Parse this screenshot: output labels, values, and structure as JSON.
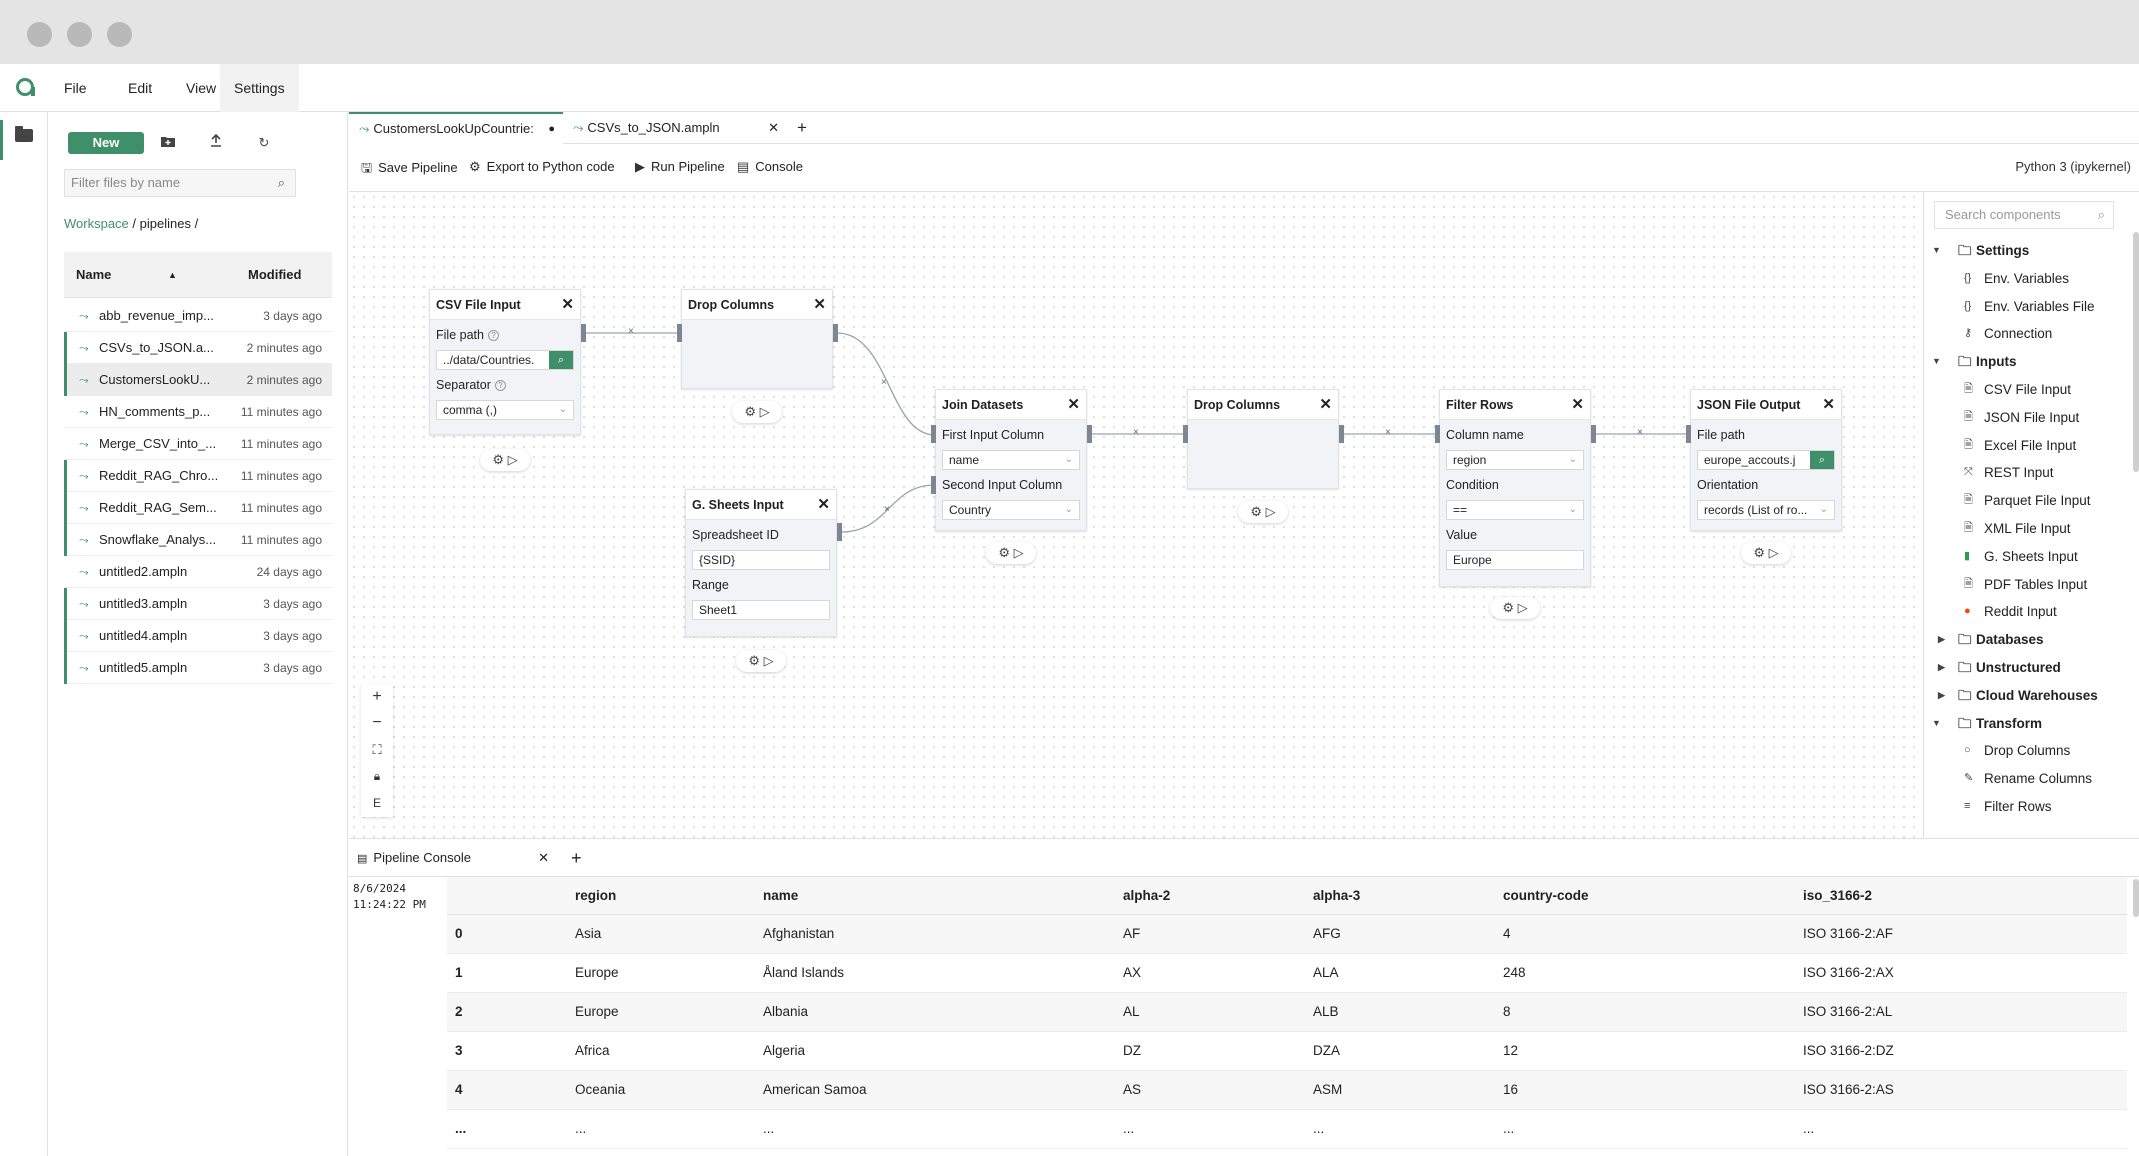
{
  "menu": {
    "file": "File",
    "edit": "Edit",
    "view": "View",
    "settings": "Settings"
  },
  "sidebar": {
    "new_label": "New",
    "filter_placeholder": "Filter files by name",
    "breadcrumb": {
      "root": "Workspace",
      "sep": " / ",
      "folder": "pipelines",
      "trail": " /"
    },
    "columns": {
      "name": "Name",
      "modified": "Modified"
    },
    "files": [
      {
        "name": "abb_revenue_imp...",
        "modified": "3 days ago"
      },
      {
        "name": "CSVs_to_JSON.a...",
        "modified": "2 minutes ago"
      },
      {
        "name": "CustomersLookU...",
        "modified": "2 minutes ago"
      },
      {
        "name": "HN_comments_p...",
        "modified": "11 minutes ago"
      },
      {
        "name": "Merge_CSV_into_...",
        "modified": "11 minutes ago"
      },
      {
        "name": "Reddit_RAG_Chro...",
        "modified": "11 minutes ago"
      },
      {
        "name": "Reddit_RAG_Sem...",
        "modified": "11 minutes ago"
      },
      {
        "name": "Snowflake_Analys...",
        "modified": "11 minutes ago"
      },
      {
        "name": "untitled2.ampln",
        "modified": "24 days ago"
      },
      {
        "name": "untitled3.ampln",
        "modified": "3 days ago"
      },
      {
        "name": "untitled4.ampln",
        "modified": "3 days ago"
      },
      {
        "name": "untitled5.ampln",
        "modified": "3 days ago"
      }
    ]
  },
  "tabs": [
    {
      "label": "CustomersLookUpCountrie:"
    },
    {
      "label": "CSVs_to_JSON.ampln"
    }
  ],
  "toolbar": {
    "save": "Save Pipeline",
    "export": "Export to Python code",
    "run": "Run Pipeline",
    "console": "Console",
    "kernel": "Python 3 (ipykernel)"
  },
  "nodes": {
    "csv": {
      "title": "CSV File Input",
      "file_label": "File path",
      "file_value": "../data/Countries.",
      "sep_label": "Separator",
      "sep_value": "comma (,)"
    },
    "drop1": {
      "title": "Drop Columns"
    },
    "sheets": {
      "title": "G. Sheets Input",
      "id_label": "Spreadsheet ID",
      "id_value": "{SSID}",
      "range_label": "Range",
      "range_value": "Sheet1"
    },
    "join": {
      "title": "Join Datasets",
      "first_label": "First Input Column",
      "first_value": "name",
      "second_label": "Second Input Column",
      "second_value": "Country"
    },
    "drop2": {
      "title": "Drop Columns"
    },
    "filter": {
      "title": "Filter Rows",
      "col_label": "Column name",
      "col_value": "region",
      "cond_label": "Condition",
      "cond_value": "==",
      "val_label": "Value",
      "val_value": "Europe"
    },
    "json": {
      "title": "JSON File Output",
      "file_label": "File path",
      "file_value": "europe_accouts.j",
      "orient_label": "Orientation",
      "orient_value": "records (List of ro..."
    }
  },
  "components": {
    "search_placeholder": "Search components",
    "tree": [
      {
        "type": "cat",
        "label": "Settings",
        "open": true
      },
      {
        "type": "item",
        "label": "Env. Variables",
        "icon": "braces-icon"
      },
      {
        "type": "item",
        "label": "Env. Variables File",
        "icon": "braces-icon"
      },
      {
        "type": "item",
        "label": "Connection",
        "icon": "key-icon"
      },
      {
        "type": "cat",
        "label": "Inputs",
        "open": true
      },
      {
        "type": "item",
        "label": "CSV File Input",
        "icon": "file-icon"
      },
      {
        "type": "item",
        "label": "JSON File Input",
        "icon": "file-icon"
      },
      {
        "type": "item",
        "label": "Excel File Input",
        "icon": "file-icon"
      },
      {
        "type": "item",
        "label": "REST Input",
        "icon": "api-icon"
      },
      {
        "type": "item",
        "label": "Parquet File Input",
        "icon": "file-icon"
      },
      {
        "type": "item",
        "label": "XML File Input",
        "icon": "file-icon"
      },
      {
        "type": "item",
        "label": "G. Sheets Input",
        "icon": "sheets-icon"
      },
      {
        "type": "item",
        "label": "PDF Tables Input",
        "icon": "file-icon"
      },
      {
        "type": "item",
        "label": "Reddit Input",
        "icon": "reddit-icon"
      },
      {
        "type": "cat",
        "label": "Databases",
        "open": false
      },
      {
        "type": "cat",
        "label": "Unstructured",
        "open": false
      },
      {
        "type": "cat",
        "label": "Cloud Warehouses",
        "open": false
      },
      {
        "type": "cat",
        "label": "Transform",
        "open": true
      },
      {
        "type": "item",
        "label": "Drop Columns",
        "icon": "drop-icon"
      },
      {
        "type": "item",
        "label": "Rename Columns",
        "icon": "edit-icon"
      },
      {
        "type": "item",
        "label": "Filter Rows",
        "icon": "filter-icon"
      }
    ]
  },
  "console": {
    "tab": "Pipeline Console",
    "date": "8/6/2024",
    "time": "11:24:22 PM",
    "columns": [
      "region",
      "name",
      "alpha-2",
      "alpha-3",
      "country-code",
      "iso_3166-2"
    ],
    "rows": [
      [
        "0",
        "Asia",
        "Afghanistan",
        "AF",
        "AFG",
        "4",
        "ISO 3166-2:AF"
      ],
      [
        "1",
        "Europe",
        "Åland Islands",
        "AX",
        "ALA",
        "248",
        "ISO 3166-2:AX"
      ],
      [
        "2",
        "Europe",
        "Albania",
        "AL",
        "ALB",
        "8",
        "ISO 3166-2:AL"
      ],
      [
        "3",
        "Africa",
        "Algeria",
        "DZ",
        "DZA",
        "12",
        "ISO 3166-2:DZ"
      ],
      [
        "4",
        "Oceania",
        "American Samoa",
        "AS",
        "ASM",
        "16",
        "ISO 3166-2:AS"
      ],
      [
        "...",
        "...",
        "...",
        "...",
        "...",
        "...",
        "..."
      ]
    ]
  }
}
